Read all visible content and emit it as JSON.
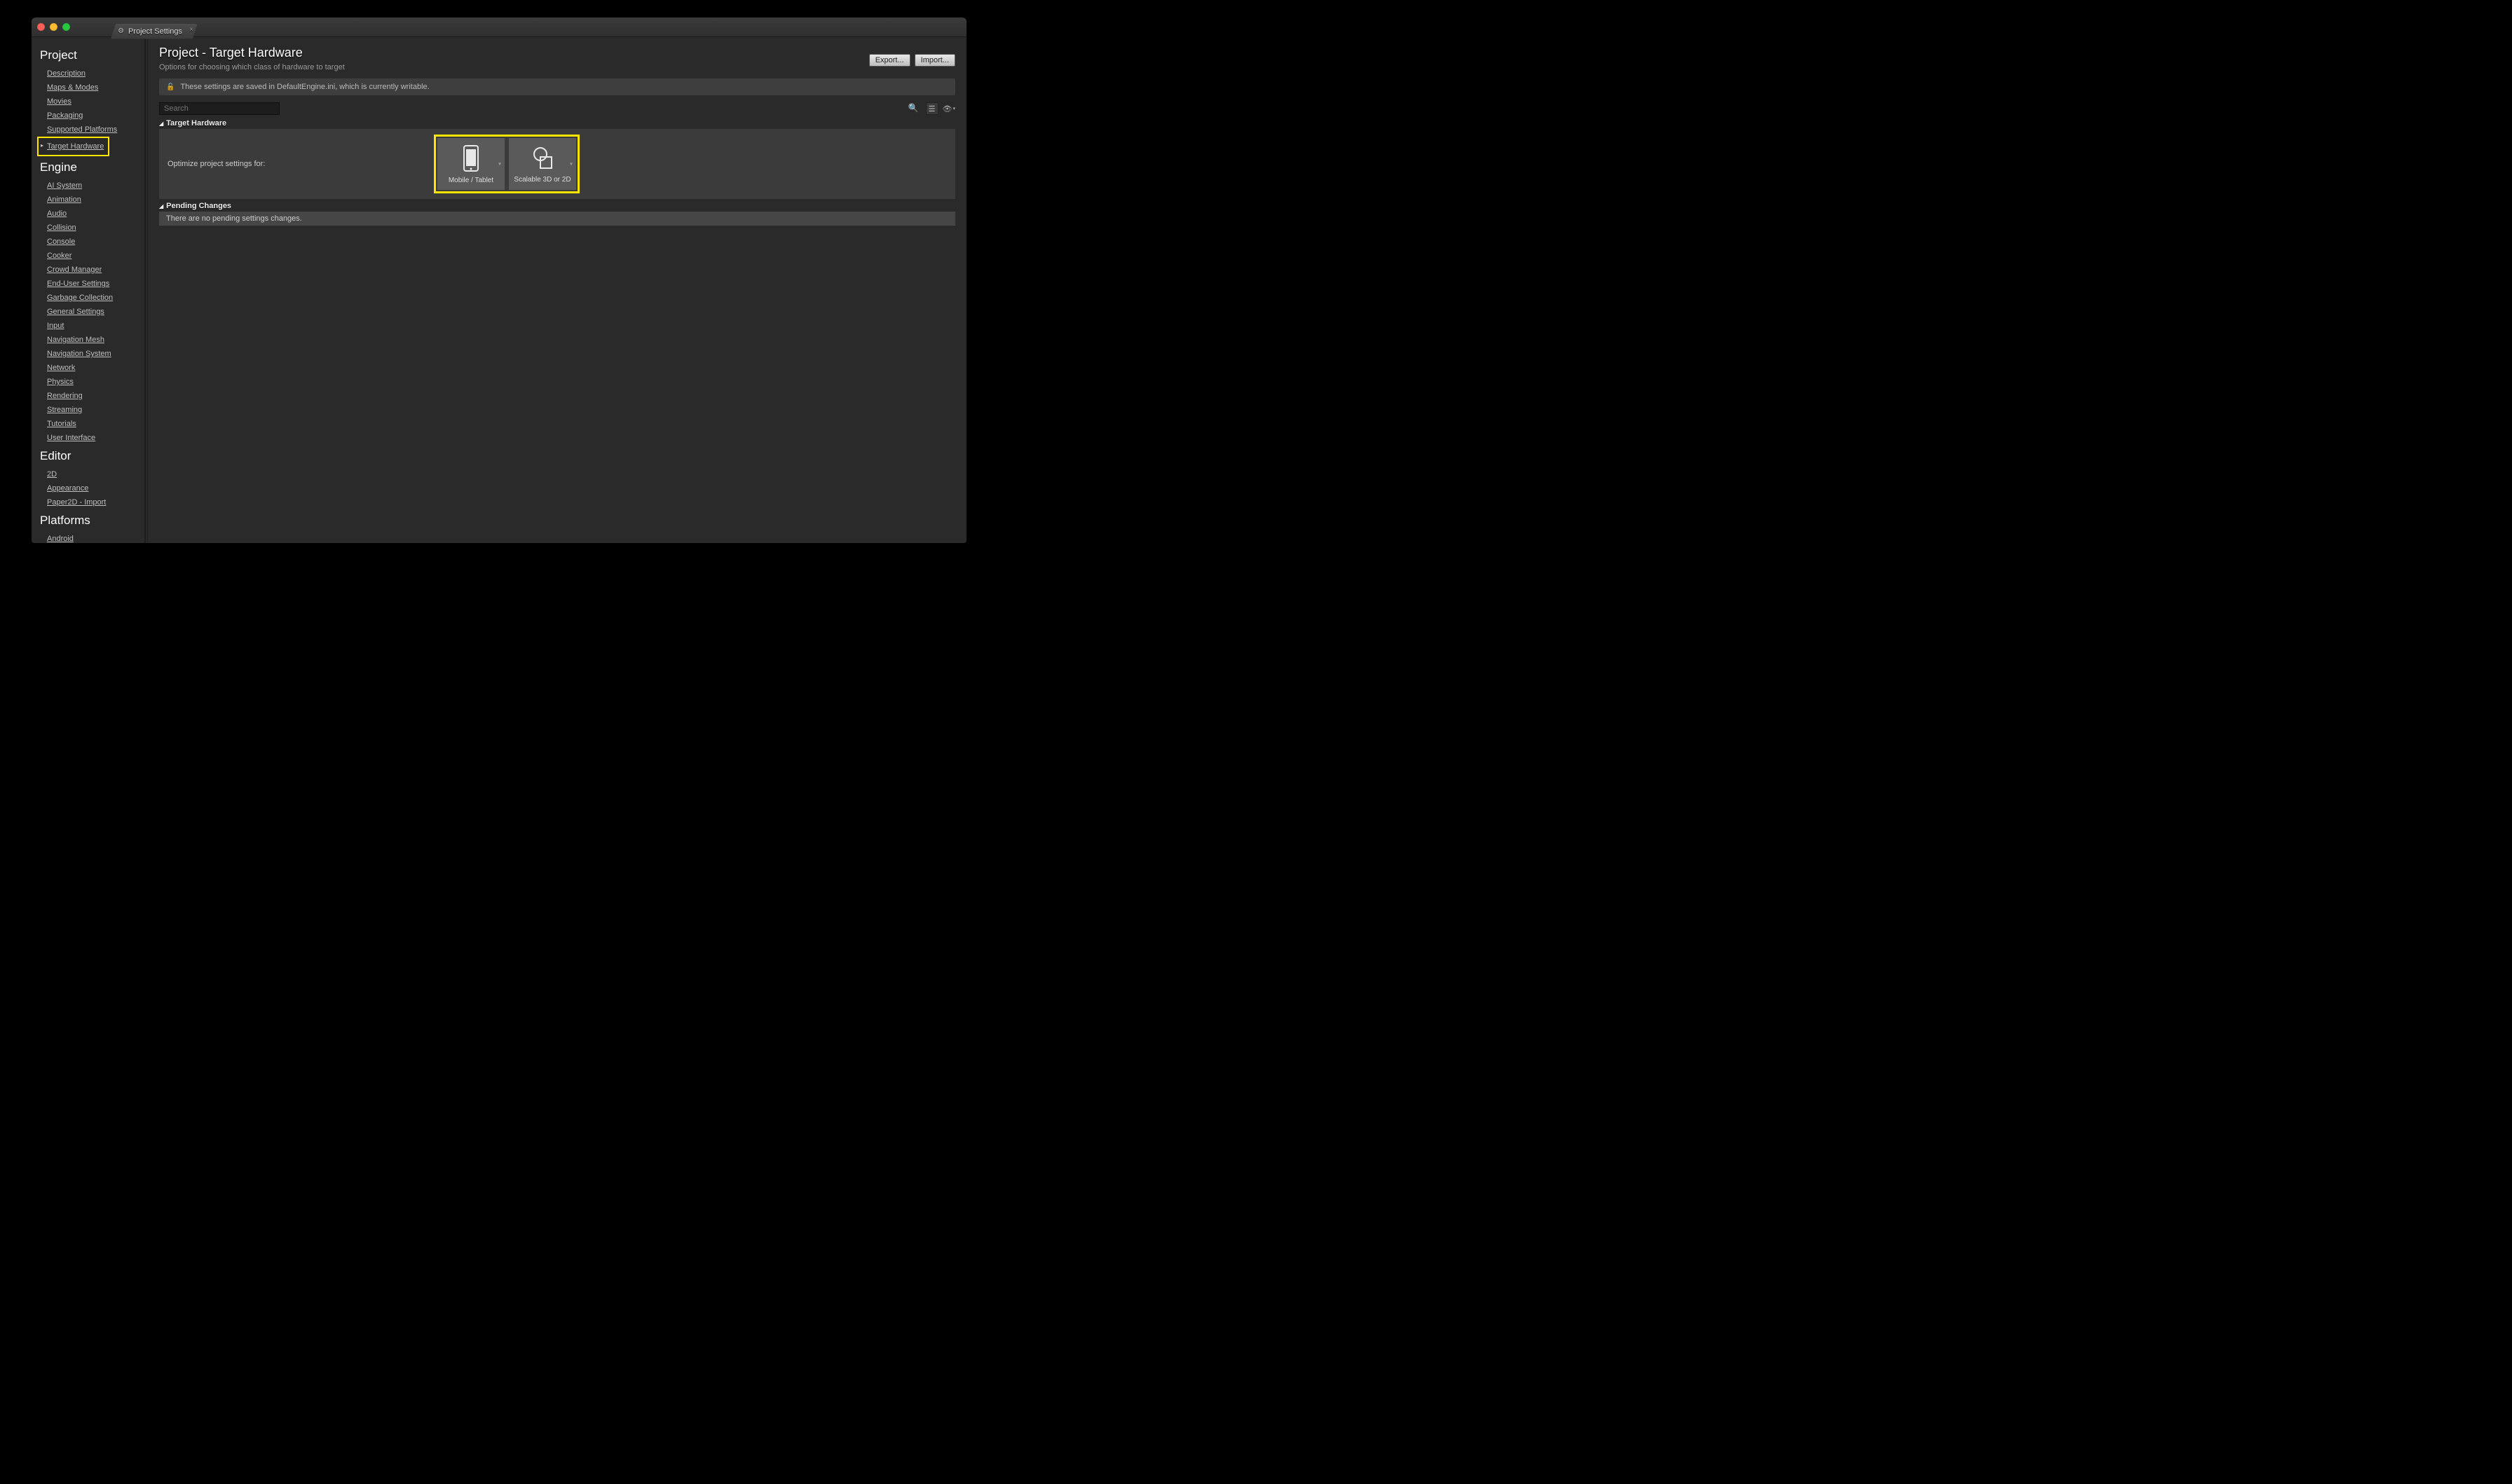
{
  "tab": {
    "title": "Project Settings"
  },
  "sidebar": {
    "sections": [
      {
        "title": "Project",
        "items": [
          "Description",
          "Maps & Modes",
          "Movies",
          "Packaging",
          "Supported Platforms",
          "Target Hardware"
        ],
        "selected": 5,
        "highlighted": 5
      },
      {
        "title": "Engine",
        "items": [
          "AI System",
          "Animation",
          "Audio",
          "Collision",
          "Console",
          "Cooker",
          "Crowd Manager",
          "End-User Settings",
          "Garbage Collection",
          "General Settings",
          "Input",
          "Navigation Mesh",
          "Navigation System",
          "Network",
          "Physics",
          "Rendering",
          "Streaming",
          "Tutorials",
          "User Interface"
        ]
      },
      {
        "title": "Editor",
        "items": [
          "2D",
          "Appearance",
          "Paper2D - Import"
        ]
      },
      {
        "title": "Platforms",
        "items": [
          "Android"
        ]
      }
    ]
  },
  "main": {
    "title": "Project - Target Hardware",
    "subtitle": "Options for choosing which class of hardware to target",
    "export_label": "Export...",
    "import_label": "Import...",
    "notice": "These settings are saved in DefaultEngine.ini, which is currently writable.",
    "search_placeholder": "Search",
    "sections": {
      "target_hardware": {
        "title": "Target Hardware",
        "optimize_label": "Optimize project settings for:",
        "picker1": "Mobile / Tablet",
        "picker2": "Scalable 3D or 2D"
      },
      "pending": {
        "title": "Pending Changes",
        "text": "There are no pending settings changes."
      }
    }
  }
}
